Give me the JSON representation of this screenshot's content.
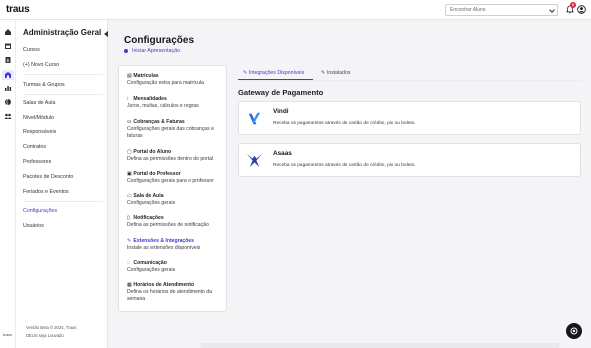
{
  "header": {
    "logo": "traus",
    "search_placeholder": "Encontrar Aluno",
    "notification_count": "0"
  },
  "rail": {
    "logo": "traus"
  },
  "sidebar": {
    "title": "Administração Geral",
    "items": [
      {
        "label": "Cursos"
      },
      {
        "label": "(+) Novo Curso"
      },
      {
        "label": "Turmas & Grupos"
      },
      {
        "label": "Salas de Aula"
      },
      {
        "label": "Nível/Módulo"
      },
      {
        "label": "Responsáveis"
      },
      {
        "label": "Contratos"
      },
      {
        "label": "Professores"
      },
      {
        "label": "Pacotes de Desconto"
      },
      {
        "label": "Feriados e Eventos"
      },
      {
        "label": "Configurações"
      },
      {
        "label": "Usuários"
      }
    ],
    "footer_version": "Versão Beta © 2024, Traus",
    "footer_motto": "DEUS seja Louvado"
  },
  "main": {
    "title": "Configurações",
    "start_tour": "Iniciar Apresentação"
  },
  "settings_menu": [
    {
      "icon": "▤",
      "title": "Matrículas",
      "desc": "Configuração extra para matrícula"
    },
    {
      "icon": "⁝",
      "title": "Mensalidades",
      "desc": "Juros, multas, cálculos e regras"
    },
    {
      "icon": "⛀",
      "title": "Cobranças & Faturas",
      "desc": "Configurações gerais das cobranças e faturas"
    },
    {
      "icon": "▢",
      "title": "Portal do Aluno",
      "desc": "Defina as permissões dentro do portal"
    },
    {
      "icon": "▣",
      "title": "Portal do Professor",
      "desc": "Configurações gerais para o professor"
    },
    {
      "icon": "▭",
      "title": "Sala de Aula",
      "desc": "Configurações gerais"
    },
    {
      "icon": "▯",
      "title": "Notificações",
      "desc": "Defina as permissões de notificação"
    },
    {
      "icon": "✎",
      "title": "Extensões & Integrações",
      "desc": "Instale as extensões disponíveis"
    },
    {
      "icon": "◌",
      "title": "Comunicação",
      "desc": "Configurações gerais"
    },
    {
      "icon": "▦",
      "title": "Horários de Atendimento",
      "desc": "Defina os horários de atendimento da semana"
    }
  ],
  "tabs": [
    {
      "label": "Integrações Disponíveis"
    },
    {
      "label": "Instalados"
    }
  ],
  "section": {
    "title": "Gateway de Pagamento"
  },
  "integrations": [
    {
      "name": "Vindi",
      "desc": "Receba os pagamentos através de cartão de crédito, pix ou boleto."
    },
    {
      "name": "Asaas",
      "desc": "Receba os pagamentos através de cartão de crédito, pix ou boleto."
    }
  ],
  "colors": {
    "accent": "#3b3bd6",
    "vindi_blue": "#1f6fd6",
    "asaas_blue": "#2a3fae"
  }
}
